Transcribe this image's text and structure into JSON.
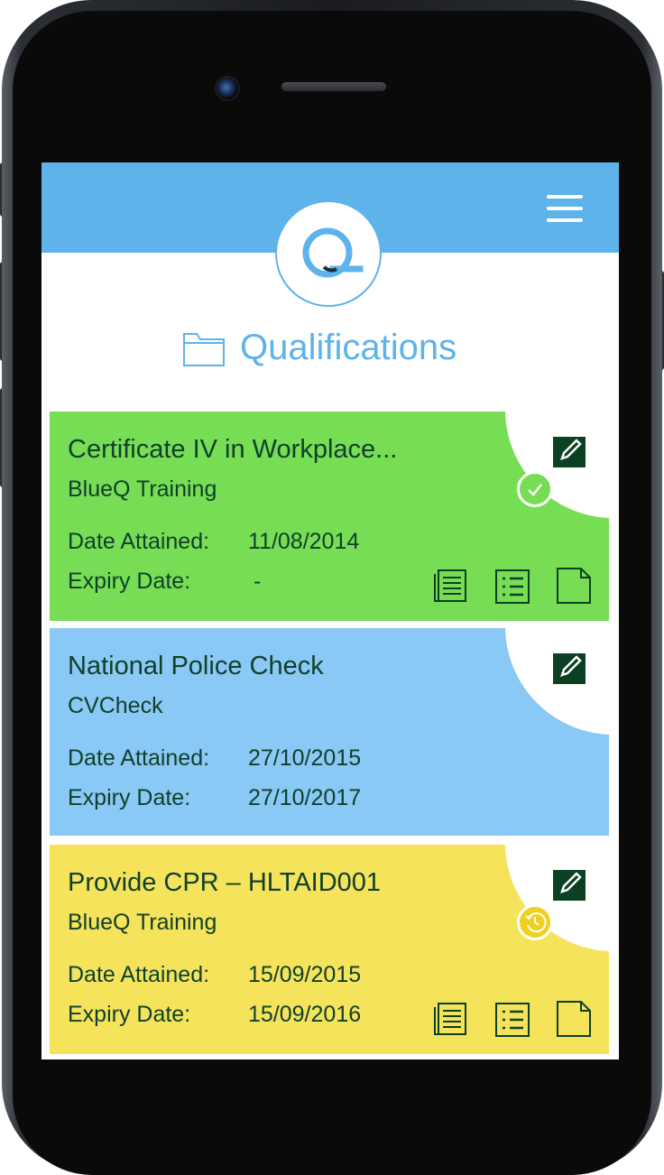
{
  "app": {
    "page_title": "Qualifications",
    "menu_icon": "hamburger-menu-icon",
    "logo_letter": "Q",
    "accent_color": "#5db3ea"
  },
  "qualifications": [
    {
      "title": "Certificate IV in Workplace...",
      "provider": "BlueQ Training",
      "date_attained_label": "Date Attained:",
      "date_attained": "11/08/2014",
      "expiry_label": "Expiry Date:",
      "expiry": "-",
      "color": "#77dd55",
      "status": "check-circle-icon"
    },
    {
      "title": "National Police Check",
      "provider": "CVCheck",
      "date_attained_label": "Date Attained:",
      "date_attained": "27/10/2015",
      "expiry_label": "Expiry Date:",
      "expiry": "27/10/2017",
      "color": "#8ac8f5",
      "status": "none"
    },
    {
      "title": "Provide CPR – HLTAID001",
      "provider": "BlueQ Training",
      "date_attained_label": "Date Attained:",
      "date_attained": "15/09/2015",
      "expiry_label": "Expiry Date:",
      "expiry": "15/09/2016",
      "color": "#f5e35c",
      "status": "history-clock-icon"
    }
  ]
}
